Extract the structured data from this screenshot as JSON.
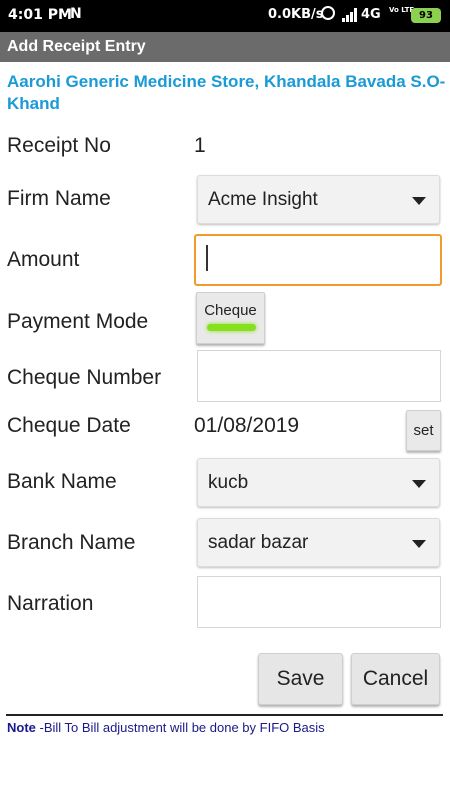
{
  "status_bar": {
    "time": "4:01 PM",
    "notification": "N",
    "speed": "0.0KB/s",
    "network": "4G",
    "volte": "Vo LTE",
    "battery": "93"
  },
  "header": {
    "title": "Add Receipt Entry"
  },
  "store_name": "Aarohi Generic Medicine Store, Khandala Bavada S.O-Khand",
  "form": {
    "receipt_no_label": "Receipt No",
    "receipt_no_value": "1",
    "firm_label": "Firm Name",
    "firm_value": "Acme Insight",
    "amount_label": "Amount",
    "amount_value": "",
    "payment_mode_label": "Payment Mode",
    "payment_mode_value": "Cheque",
    "cheque_number_label": "Cheque Number",
    "cheque_number_value": "",
    "cheque_date_label": "Cheque Date",
    "cheque_date_value": "01/08/2019",
    "set_label": "set",
    "bank_label": "Bank Name",
    "bank_value": "kucb",
    "branch_label": "Branch Name",
    "branch_value": "sadar bazar",
    "narration_label": "Narration",
    "narration_value": ""
  },
  "actions": {
    "save": "Save",
    "cancel": "Cancel"
  },
  "footer": {
    "note_label": "Note",
    "note_text": " -Bill To Bill adjustment will be done by FIFO Basis"
  },
  "colors": {
    "accent": "#1a9ad6",
    "title_bar": "#6b6b6b",
    "focus": "#f19a2e",
    "toggle_on": "#86e01e"
  }
}
